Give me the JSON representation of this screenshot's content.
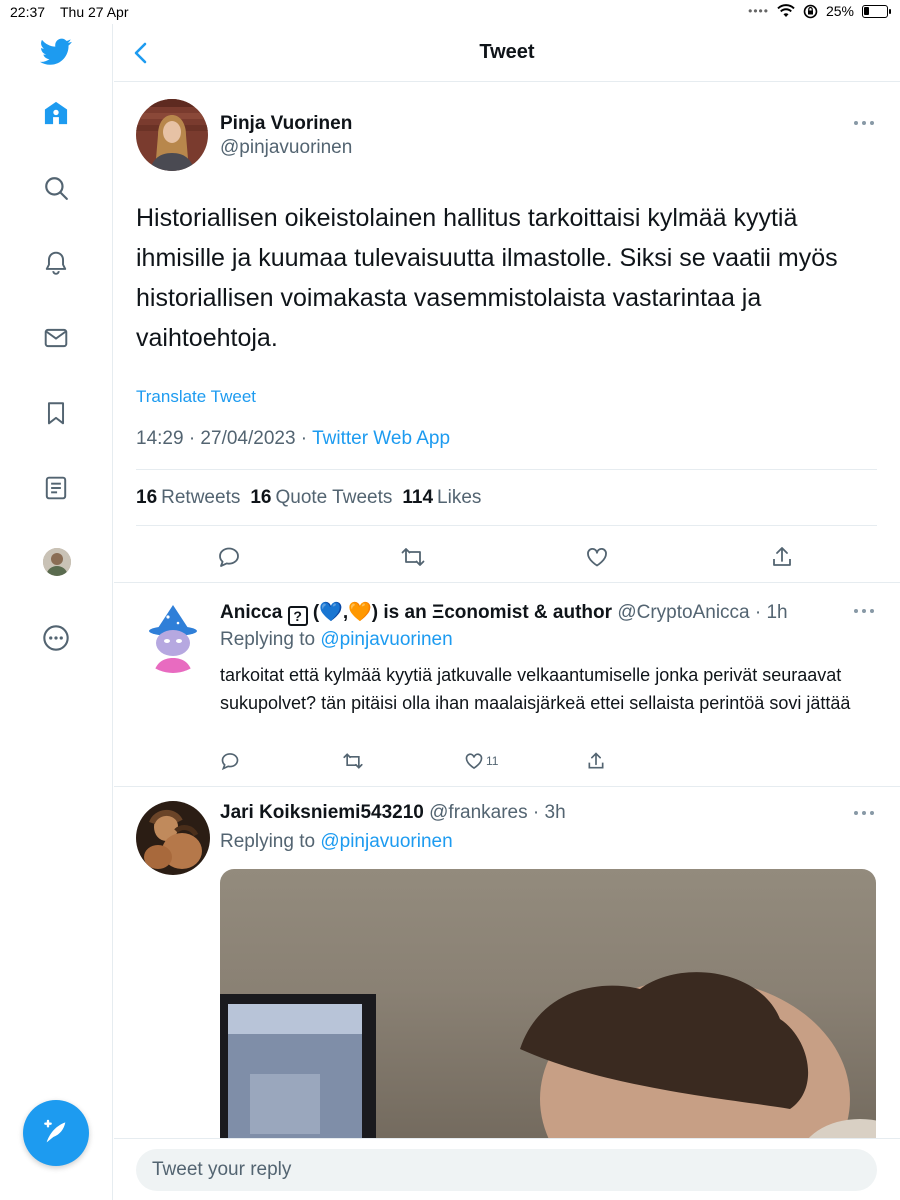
{
  "statusbar": {
    "time": "22:37",
    "date": "Thu 27 Apr",
    "battery": "25%",
    "battery_level": 0.25,
    "icons": [
      "wifi-icon",
      "orientation-lock-icon",
      "battery-icon"
    ]
  },
  "nav": {
    "items": [
      "twitter-logo-icon",
      "home-icon",
      "search-icon",
      "notifications-icon",
      "messages-icon",
      "bookmarks-icon",
      "lists-icon",
      "profile-avatar",
      "more-icon"
    ],
    "active": "home-icon",
    "compose_icon": "compose-tweet-icon"
  },
  "header": {
    "title": "Tweet"
  },
  "tweet": {
    "author_name": "Pinja Vuorinen",
    "author_handle": "@pinjavuorinen",
    "text": "Historiallisen oikeistolainen hallitus tarkoittaisi kylmää kyytiä ihmisille ja kuumaa tulevaisuutta ilmastolle. Siksi se vaatii myös historiallisen voimakasta vasemmistolaista vastarintaa ja vaihtoehtoja.",
    "translate": "Translate Tweet",
    "timestamp": "14:29 · 27/04/2023 · ",
    "source": "Twitter Web App",
    "retweets_count": "16",
    "retweets_label": "Retweets",
    "quotes_count": "16",
    "quotes_label": "Quote Tweets",
    "likes_count": "114",
    "likes_label": "Likes"
  },
  "replies": [
    {
      "name_prefix": "Anicca ",
      "name_box": "?",
      "name_emoji": " (💙,🧡) is an Ξconomist & author",
      "handle_time": " @CryptoAnicca · 1h",
      "replying_label": "Replying to ",
      "replying_to": "@pinjavuorinen",
      "text": "tarkoitat että kylmää kyytiä jatkuvalle velkaantumiselle jonka perivät seuraavat sukupolvet? tän pitäisi olla ihan maalaisjärkeä ettei sellaista perintöä sovi jättää",
      "likes": "11"
    },
    {
      "name": "Jari Koiksniemi543210",
      "handle_time": " @frankares · 3h",
      "replying_label": "Replying to ",
      "replying_to": "@pinjavuorinen"
    }
  ],
  "composer": {
    "placeholder": "Tweet your reply"
  },
  "colors": {
    "accent": "#1d9bf0",
    "text": "#0f1419",
    "muted": "#536471",
    "border": "#e6ecf0"
  }
}
